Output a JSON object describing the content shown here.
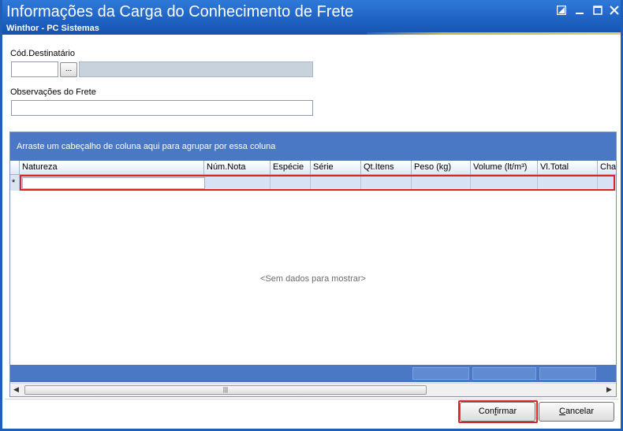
{
  "window": {
    "title": "Informações da Carga do Conhecimento de Frete",
    "subtitle": "Winthor - PC Sistemas",
    "controls": [
      "restore-icon",
      "minimize-icon",
      "maximize-icon",
      "close-icon"
    ]
  },
  "form": {
    "destinatario_label": "Cód.Destinatário",
    "destinatario_value": "",
    "destinatario_name": "",
    "lookup_button": "...",
    "observacoes_label": "Observações do Frete",
    "observacoes_value": ""
  },
  "grid": {
    "group_panel_text": "Arraste um cabeçalho de coluna aqui para agrupar por essa coluna",
    "columns": [
      "Natureza",
      "Núm.Nota",
      "Espécie",
      "Série",
      "Qt.Itens",
      "Peso (kg)",
      "Volume (lt/m³)",
      "Vl.Total",
      "Chave"
    ],
    "new_row_marker": "*",
    "empty_text": "<Sem dados para mostrar>"
  },
  "buttons": {
    "confirm_pre": "Con",
    "confirm_ul": "f",
    "confirm_post": "irmar",
    "cancel_ul": "C",
    "cancel_post": "ancelar"
  },
  "colors": {
    "titlebar": "#1f63c4",
    "group_panel": "#4a78c4",
    "highlight": "#e0202a"
  }
}
